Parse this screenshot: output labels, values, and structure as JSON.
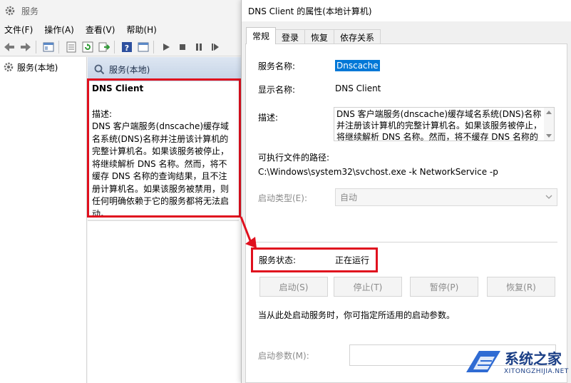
{
  "services_window": {
    "title": "服务",
    "menu": [
      "文件(F)",
      "操作(A)",
      "查看(V)",
      "帮助(H)"
    ],
    "tree_node": "服务(本地)",
    "pane_header": "服务(本地)",
    "selected_service_name": "DNS Client",
    "description_label": "描述:",
    "description_text": "DNS 客户端服务(dnscache)缓存域名系统(DNS)名称并注册该计算机的完整计算机名。如果该服务被停止，将继续解析 DNS 名称。然而，将不缓存 DNS 名称的查询结果，且不注册计算机名。如果该服务被禁用，则任何明确依赖于它的服务都将无法启动。"
  },
  "dialog": {
    "title": "DNS Client 的属性(本地计算机)",
    "tabs": [
      "常规",
      "登录",
      "恢复",
      "依存关系"
    ],
    "service_name_label": "服务名称:",
    "service_name_value": "Dnscache",
    "display_name_label": "显示名称:",
    "display_name_value": "DNS Client",
    "description_label": "描述:",
    "description_value": "DNS 客户端服务(dnscache)缓存域名系统(DNS)名称并注册该计算机的完整计算机名。如果该服务被停止，将继续解析 DNS 名称。然而，将不缓存 DNS 名称的",
    "exe_path_label": "可执行文件的路径:",
    "exe_path_value": "C:\\Windows\\system32\\svchost.exe -k NetworkService -p",
    "startup_type_label": "启动类型(E):",
    "startup_type_value": "自动",
    "status_label": "服务状态:",
    "status_value": "正在运行",
    "buttons": [
      "启动(S)",
      "停止(T)",
      "暂停(P)",
      "恢复(R)"
    ],
    "start_hint": "当从此处启动服务时，你可指定所适用的启动参数。",
    "start_params_label": "启动参数(M):"
  },
  "watermark": {
    "site_name": "系统之家",
    "site_url": "XITONGZHIJIA.NET"
  },
  "colors": {
    "highlight_red": "#e0101e",
    "selection_blue": "#0078d7",
    "watermark_blue": "#1b3f86"
  }
}
